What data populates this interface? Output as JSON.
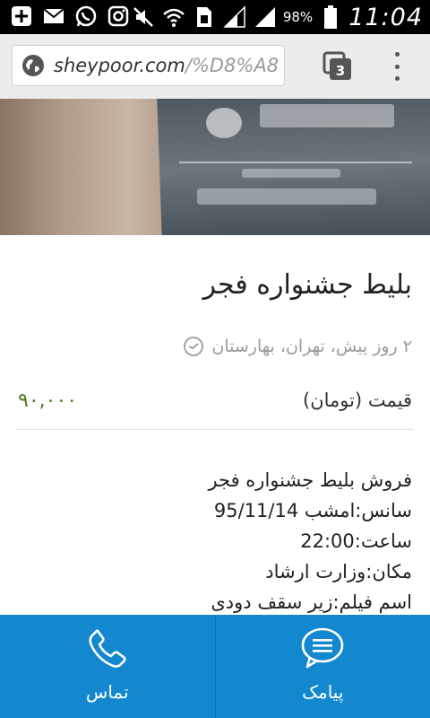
{
  "status_bar": {
    "battery_percent": "98%",
    "time": "11:04",
    "icons": [
      "add-icon",
      "mail-icon",
      "whatsapp-icon",
      "instagram-icon",
      "mute-icon",
      "wifi-icon",
      "sim-icon",
      "signal-icon",
      "signal-full-icon",
      "battery-icon"
    ]
  },
  "browser": {
    "url_host": "sheypoor.com",
    "url_path": "/%D8%A8",
    "tab_count": "3"
  },
  "listing": {
    "title": "بلیط جشنواره فجر",
    "meta": "۲ روز پیش، تهران، بهارستان",
    "price_label": "قیمت (تومان)",
    "price_value": "۹۰,۰۰۰",
    "description_lines": [
      "فروش بلیط جشنواره فجر",
      "سانس:امشب 95/11/14",
      "ساعت:22:00",
      "مکان:وزارت ارشاد",
      "اسم فیلم:زیر سقف دودی"
    ]
  },
  "actions": {
    "call_label": "تماس",
    "sms_label": "پیامک"
  },
  "colors": {
    "action_bar": "#1488cf",
    "price": "#4d7a1f",
    "meta_text": "#9b9b9b"
  }
}
